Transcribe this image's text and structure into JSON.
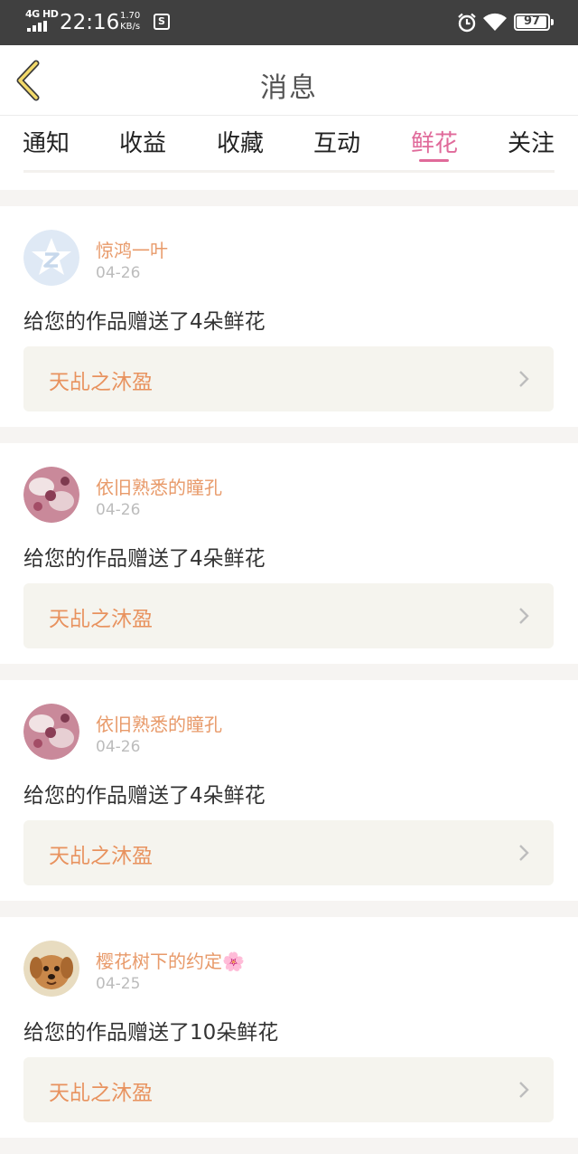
{
  "status_bar": {
    "network": "4G HD",
    "time": "22:16",
    "speed_value": "1.70",
    "speed_unit": "KB/s",
    "battery": "97",
    "battery_level": 0.97
  },
  "header": {
    "title": "消息"
  },
  "tabs": [
    {
      "label": "通知",
      "active": false
    },
    {
      "label": "收益",
      "active": false
    },
    {
      "label": "收藏",
      "active": false
    },
    {
      "label": "互动",
      "active": false
    },
    {
      "label": "鲜花",
      "active": true
    },
    {
      "label": "关注",
      "active": false
    }
  ],
  "colors": {
    "accent": "#e06a9a",
    "username": "#e89a6a",
    "work_title": "#e8925e"
  },
  "messages": [
    {
      "user": "惊鸿一叶",
      "date": "04-26",
      "text": "给您的作品赠送了4朵鲜花",
      "work": "天乩之沐盈",
      "avatar": "default-avatar-icon"
    },
    {
      "user": "依旧熟悉的瞳孔",
      "date": "04-26",
      "text": "给您的作品赠送了4朵鲜花",
      "work": "天乩之沐盈",
      "avatar": "user-avatar-photo"
    },
    {
      "user": "依旧熟悉的瞳孔",
      "date": "04-26",
      "text": "给您的作品赠送了4朵鲜花",
      "work": "天乩之沐盈",
      "avatar": "user-avatar-photo"
    },
    {
      "user": "樱花树下的约定🌸",
      "date": "04-25",
      "text": "给您的作品赠送了10朵鲜花",
      "work": "天乩之沐盈",
      "avatar": "dog-avatar-photo"
    }
  ]
}
